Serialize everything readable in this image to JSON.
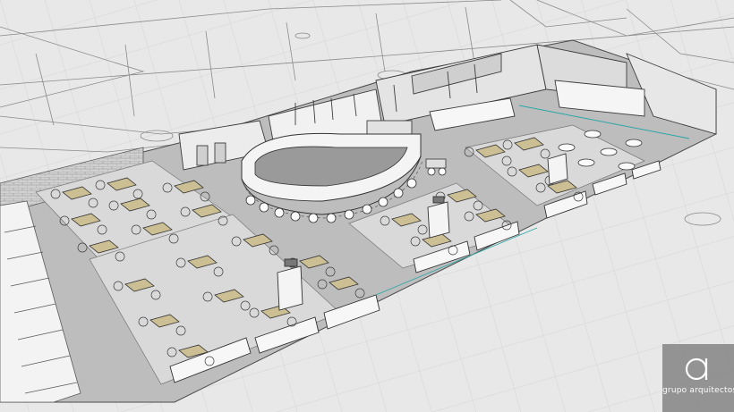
{
  "image": {
    "kind": "architectural-3d-render",
    "subject": "restaurant-floor-plan",
    "palette": {
      "floor": "#bdbdbd",
      "tile": "#d9d9d9",
      "line": "#3c3c3c",
      "table_top": "#cbbf93",
      "wall_fill": "#ececec",
      "counter": "#f4f4f4",
      "accent": "#2aa6a6"
    }
  },
  "watermark": {
    "brand": "grupo arquitectos",
    "logo_letter": "a"
  }
}
